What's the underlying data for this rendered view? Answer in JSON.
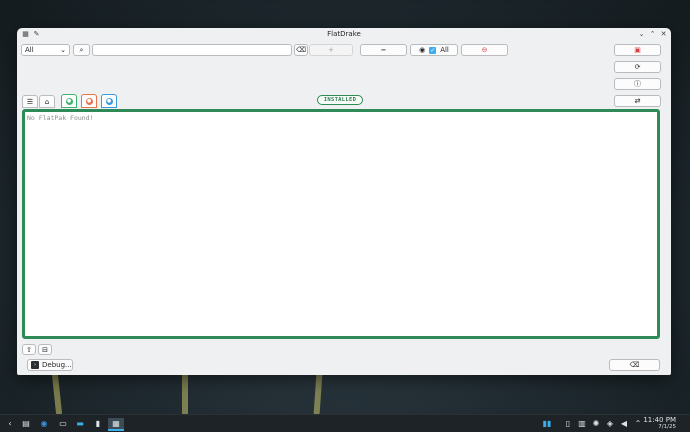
{
  "window": {
    "title": "FlatDrake"
  },
  "toolbar": {
    "filter_value": "All",
    "search_placeholder": "",
    "add_label": "+",
    "remove_label": "−",
    "all_checkbox_label": "All"
  },
  "tabs": [
    {
      "name": "list-view",
      "icon": "list-icon"
    },
    {
      "name": "app-view",
      "icon": "package-icon"
    },
    {
      "name": "green",
      "color": "#3cb371"
    },
    {
      "name": "red",
      "color": "#e8734a"
    },
    {
      "name": "blue",
      "color": "#3a9ad9"
    }
  ],
  "status": {
    "badge": "INSTALLED"
  },
  "content": {
    "empty_message": "No FlatPak Found!"
  },
  "footer": {
    "debug_label": "Debug..."
  },
  "taskbar": {
    "time": "11:40 PM",
    "date": "7/1/25"
  },
  "colors": {
    "accent_green": "#2e8b57",
    "danger_red": "#d64040"
  }
}
